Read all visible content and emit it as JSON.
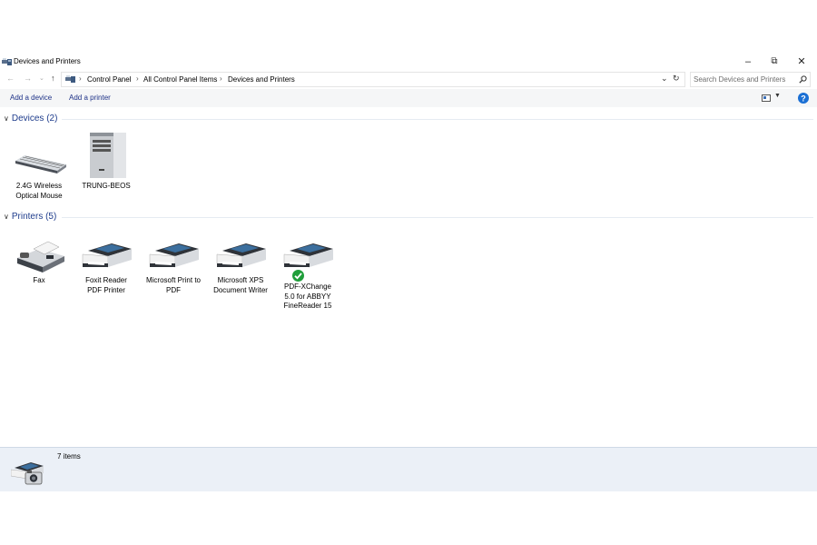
{
  "window": {
    "title": "Devices and Printers",
    "controls": {
      "minimize": "–",
      "restore": "⧉",
      "close": "✕"
    }
  },
  "address": {
    "breadcrumb": [
      "Control Panel",
      "All Control Panel Items",
      "Devices and Printers"
    ],
    "separator": "›",
    "search_placeholder": "Search Devices and Printers"
  },
  "toolbar": {
    "add_device": "Add a device",
    "add_printer": "Add a printer"
  },
  "groups": {
    "devices": {
      "header": "Devices (2)",
      "items": [
        {
          "label": "2.4G Wireless Optical Mouse",
          "icon": "keyboard-icon"
        },
        {
          "label": "TRUNG-BEOS",
          "icon": "computer-tower-icon"
        }
      ]
    },
    "printers": {
      "header": "Printers (5)",
      "items": [
        {
          "label": "Fax",
          "icon": "fax-icon"
        },
        {
          "label": "Foxit Reader PDF Printer",
          "icon": "printer-icon"
        },
        {
          "label": "Microsoft Print to PDF",
          "icon": "printer-icon"
        },
        {
          "label": "Microsoft XPS Document Writer",
          "icon": "printer-icon"
        },
        {
          "label": "PDF-XChange 5.0 for ABBYY FineReader 15",
          "icon": "printer-icon",
          "default": true
        }
      ]
    }
  },
  "details": {
    "count": "7 items",
    "icon": "devices-printers-icon"
  },
  "colors": {
    "group_header": "#1e3c8c",
    "toolbar_link": "#1e3287",
    "details_bg": "#ebf0f7",
    "default_check": "#1f9e3a"
  }
}
